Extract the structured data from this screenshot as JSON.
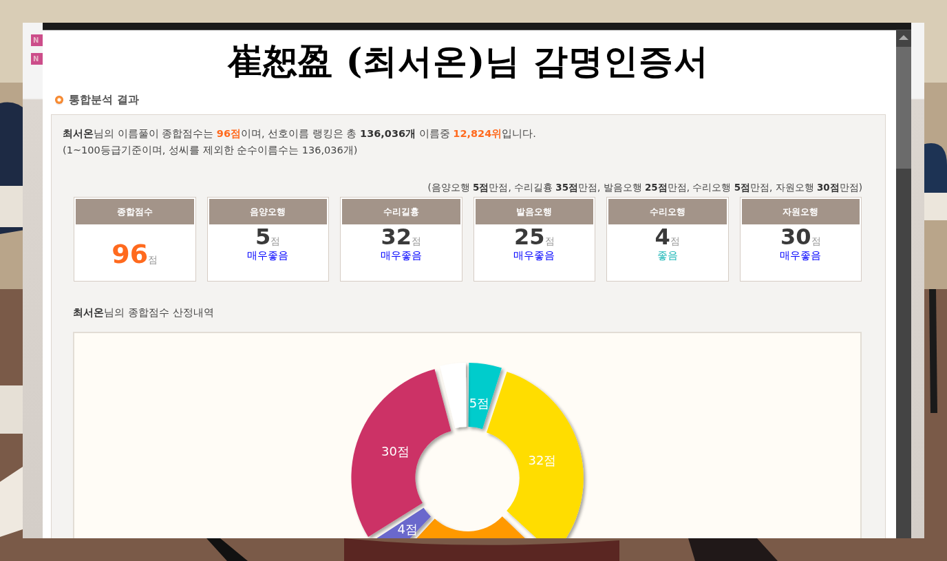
{
  "background_page": {
    "badges": [
      "N",
      "N"
    ]
  },
  "popup": {
    "title": "崔恕盈 (최서온)님 감명인증서",
    "section_heading": "통합분석 결과",
    "summary": [
      {
        "kind": "strong",
        "text": "최서온"
      },
      {
        "kind": "plain",
        "text": "님의 이름풀이 종합점수는 "
      },
      {
        "kind": "accent",
        "text": "96점"
      },
      {
        "kind": "plain",
        "text": "이며, 선호이름 랭킹은 총 "
      },
      {
        "kind": "strong",
        "text": "136,036개"
      },
      {
        "kind": "plain",
        "text": " 이름중 "
      },
      {
        "kind": "accent",
        "text": "12,824위"
      },
      {
        "kind": "plain",
        "text": "입니다."
      }
    ],
    "summary_note": "(1~100등급기준이며, 성씨를 제외한 순수이름수는 136,036개)",
    "max_scores_note": "(음양오행 **5점**만점, 수리길흉 **35점**만점, 발음오행 **25점**만점, 수리오행 **5점**만점, 자원오행 **30점**만점)",
    "score_cards": [
      {
        "kind": "total",
        "label": "종합점수",
        "value": "96",
        "unit": "점"
      },
      {
        "kind": "element",
        "label": "음양오행",
        "value": "5",
        "unit": "점",
        "grade": "매우좋음",
        "color": "#0000ff"
      },
      {
        "kind": "element",
        "label": "수리길흉",
        "value": "32",
        "unit": "점",
        "grade": "매우좋음",
        "color": "#0000ff"
      },
      {
        "kind": "element",
        "label": "발음오행",
        "value": "25",
        "unit": "점",
        "grade": "매우좋음",
        "color": "#0000ff"
      },
      {
        "kind": "element",
        "label": "수리오행",
        "value": "4",
        "unit": "점",
        "grade": "좋음",
        "color": "#20b8b8"
      },
      {
        "kind": "element",
        "label": "자원오행",
        "value": "30",
        "unit": "점",
        "grade": "매우좋음",
        "color": "#0000ff"
      }
    ],
    "breakdown_caption": "**최서온**님의 종합점수 산정내역",
    "chart_data": {
      "type": "donut",
      "series": [
        {
          "values": [
            5,
            32,
            25,
            4,
            30,
            4
          ]
        }
      ],
      "colors": [
        "#00cccc",
        "#ffdd00",
        "#ff9900",
        "#6a67cc",
        "#cc3366",
        "#ffffff"
      ],
      "value_labels": [
        "5점",
        "32점",
        null,
        "4점",
        "30점",
        null
      ]
    }
  }
}
